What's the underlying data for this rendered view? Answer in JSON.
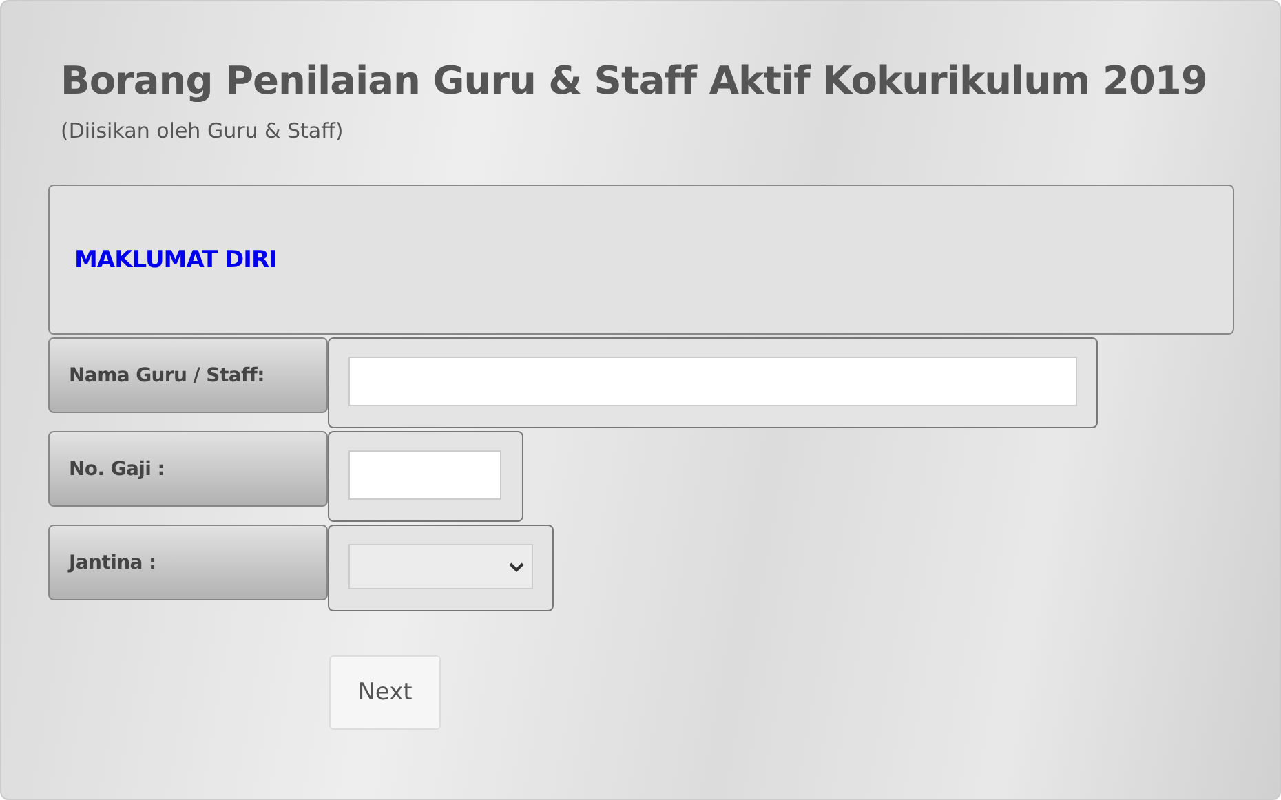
{
  "form": {
    "title": "Borang Penilaian Guru & Staff Aktif Kokurikulum 2019",
    "subtitle": "(Diisikan oleh Guru & Staff)"
  },
  "section": {
    "heading": "MAKLUMAT DIRI"
  },
  "fields": [
    {
      "label": "Nama Guru / Staff:",
      "kind": "text"
    },
    {
      "label": "No. Gaji :",
      "kind": "text"
    },
    {
      "label": "Jantina :",
      "kind": "select"
    }
  ],
  "buttons": [
    "Next"
  ]
}
